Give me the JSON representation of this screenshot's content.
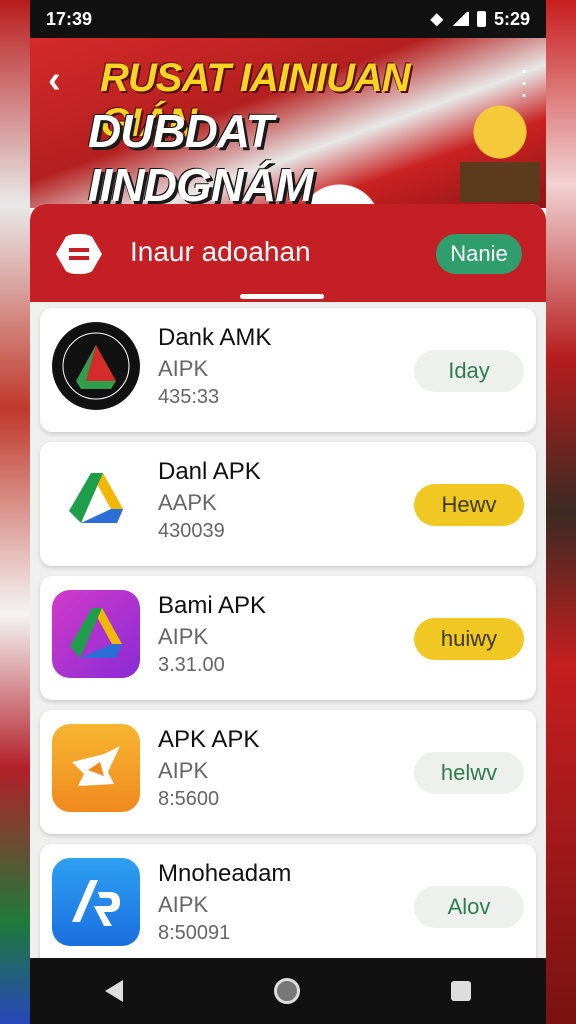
{
  "status_bar": {
    "time_left": "17:39",
    "time_right": "5:29"
  },
  "header": {
    "title_line1": "RUSAT IAINIUAN GIÁN",
    "title_line2": "DUBDAT IINDGNÁM",
    "colors": {
      "title1": "#f5d423",
      "title2": "#ffffff",
      "brand": "#c41f25"
    }
  },
  "search": {
    "text": "Inaur adoahan",
    "pill_label": "Nanie"
  },
  "apps": [
    {
      "name": "Dank AMK",
      "sub": "AIPK",
      "num": "435:33",
      "action": "Iday",
      "icon": "drive-round-icon"
    },
    {
      "name": "Danl APK",
      "sub": "AAPK",
      "num": "430039",
      "action": "Hewv",
      "icon": "drive-triangle-icon"
    },
    {
      "name": "Bami APK",
      "sub": "AIPK",
      "num": "3.31.00",
      "action": "huiwy",
      "icon": "drive-purple-icon"
    },
    {
      "name": "APK APK",
      "sub": "AIPK",
      "num": "8:5600",
      "action": "helwv",
      "icon": "ticket-icon"
    },
    {
      "name": "Mnoheadam",
      "sub": "AIPK",
      "num": "8:50091",
      "action": "Alov",
      "icon": "app-store-icon"
    }
  ],
  "accent_colors": {
    "green": "#2f9e6c",
    "yellow": "#f1c823"
  }
}
